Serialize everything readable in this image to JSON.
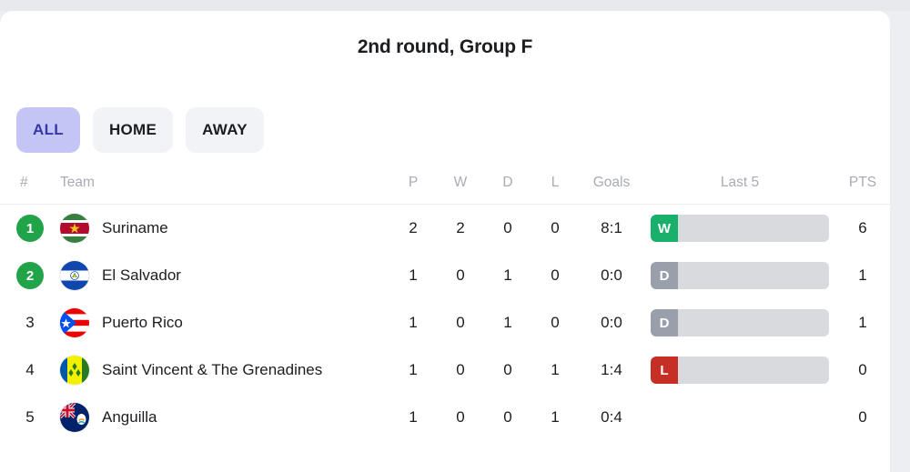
{
  "header": {
    "title": "2nd round, Group F"
  },
  "filters": {
    "items": [
      {
        "label": "ALL",
        "active": true
      },
      {
        "label": "HOME",
        "active": false
      },
      {
        "label": "AWAY",
        "active": false
      }
    ]
  },
  "table": {
    "columns": {
      "rank": "#",
      "team": "Team",
      "p": "P",
      "w": "W",
      "d": "D",
      "l": "L",
      "goals": "Goals",
      "last5": "Last 5",
      "pts": "PTS"
    },
    "rows": [
      {
        "rank": "1",
        "rank_highlighted": true,
        "team": "Suriname",
        "flag": "suriname-flag",
        "p": "2",
        "w": "2",
        "d": "0",
        "l": "0",
        "goals": "8:1",
        "last5": "W",
        "pts": "6"
      },
      {
        "rank": "2",
        "rank_highlighted": true,
        "team": "El Salvador",
        "flag": "el-salvador-flag",
        "p": "1",
        "w": "0",
        "d": "1",
        "l": "0",
        "goals": "0:0",
        "last5": "D",
        "pts": "1"
      },
      {
        "rank": "3",
        "rank_highlighted": false,
        "team": "Puerto Rico",
        "flag": "puerto-rico-flag",
        "p": "1",
        "w": "0",
        "d": "1",
        "l": "0",
        "goals": "0:0",
        "last5": "D",
        "pts": "1"
      },
      {
        "rank": "4",
        "rank_highlighted": false,
        "team": "Saint Vincent & The Grenadines",
        "flag": "saint-vincent-and-the-grenadines-flag",
        "p": "1",
        "w": "0",
        "d": "0",
        "l": "1",
        "goals": "1:4",
        "last5": "L",
        "pts": "0"
      },
      {
        "rank": "5",
        "rank_highlighted": false,
        "team": "Anguilla",
        "flag": "anguilla-flag",
        "p": "1",
        "w": "0",
        "d": "0",
        "l": "1",
        "goals": "0:4",
        "last5": "",
        "pts": "0"
      }
    ]
  },
  "colors": {
    "rank_badge": "#21a349",
    "filter_active_bg": "#c3c6f5",
    "filter_active_text": "#3b36a8",
    "form_win": "#19b06b",
    "form_draw": "#99a0ab",
    "form_loss": "#c62f25",
    "form_track": "#d8dade"
  }
}
